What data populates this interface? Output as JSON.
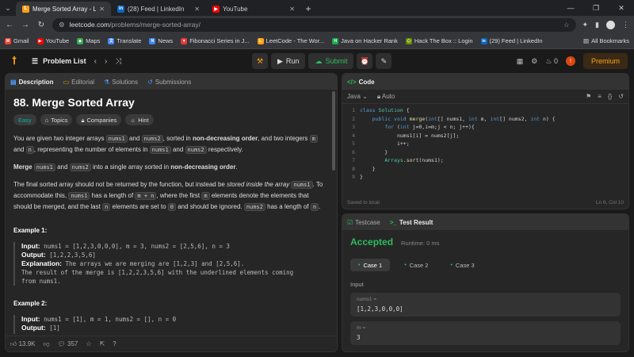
{
  "browser": {
    "tabs": [
      {
        "title": "Merge Sorted Array - LeetCode",
        "icon": "leetcode",
        "color": "#ffa116",
        "glyph": "L"
      },
      {
        "title": "(28) Feed | LinkedIn",
        "icon": "linkedin",
        "color": "#0a66c2",
        "glyph": "in"
      },
      {
        "title": "YouTube",
        "icon": "youtube",
        "color": "#ff0000",
        "glyph": "▶"
      }
    ],
    "url_host": "leetcode.com",
    "url_path": "/problems/merge-sorted-array/",
    "bookmarks": [
      {
        "label": "Gmail",
        "color": "#ea4335",
        "glyph": "M"
      },
      {
        "label": "YouTube",
        "color": "#ff0000",
        "glyph": "▶"
      },
      {
        "label": "Maps",
        "color": "#34a853",
        "glyph": "◆"
      },
      {
        "label": "Translate",
        "color": "#4285f4",
        "glyph": "文"
      },
      {
        "label": "News",
        "color": "#4285f4",
        "glyph": "N"
      },
      {
        "label": "Fibonacci Series in J...",
        "color": "#e53935",
        "glyph": "▼"
      },
      {
        "label": "LeetCode - The Wor...",
        "color": "#ffa116",
        "glyph": "L"
      },
      {
        "label": "Java on Hacker Rank",
        "color": "#1ba94c",
        "glyph": "H"
      },
      {
        "label": "Hack The Box :: Login",
        "color": "#9fef00",
        "glyph": "⬡"
      },
      {
        "label": "(29) Feed | LinkedIn",
        "color": "#0a66c2",
        "glyph": "in"
      }
    ],
    "all_bookmarks": "All Bookmarks"
  },
  "lcnav": {
    "problem_list": "Problem List",
    "run": "Run",
    "submit": "Submit",
    "streak": "0",
    "avatar": "!",
    "premium": "Premium"
  },
  "left": {
    "tabs": [
      "Description",
      "Editorial",
      "Solutions",
      "Submissions"
    ],
    "title": "88. Merge Sorted Array",
    "chips": [
      "Easy",
      "Topics",
      "Companies",
      "Hint"
    ],
    "likes": "13.9K",
    "comments": "357"
  },
  "code": {
    "header": "Code",
    "language": "Java",
    "auto": "Auto",
    "saved": "Saved to local",
    "cursor": "Ln 6, Col 10"
  },
  "test": {
    "tab_testcase": "Testcase",
    "tab_result": "Test Result",
    "status": "Accepted",
    "runtime": "Runtime: 0 ms",
    "cases": [
      "Case 1",
      "Case 2",
      "Case 3"
    ],
    "input_label": "Input",
    "params": [
      {
        "name": "nums1 =",
        "value": "[1,2,3,0,0,0]"
      },
      {
        "name": "m =",
        "value": "3"
      }
    ]
  }
}
